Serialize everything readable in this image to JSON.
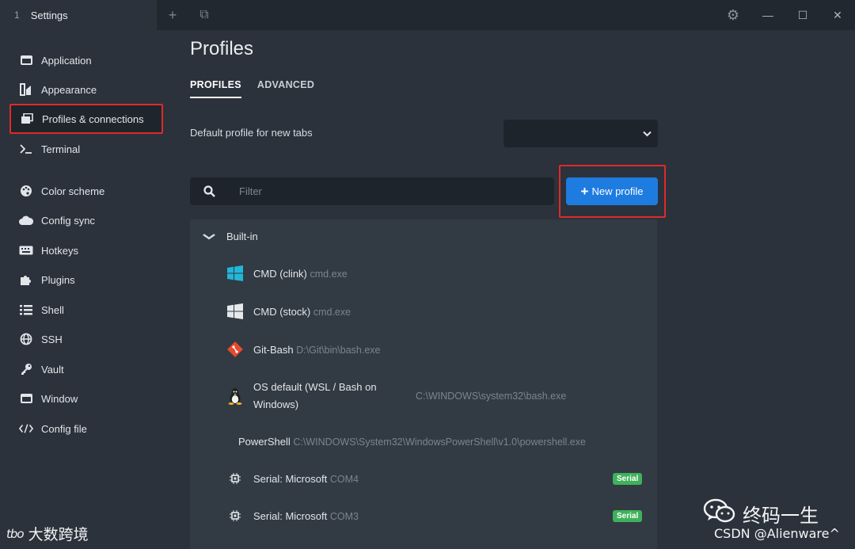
{
  "titlebar": {
    "tab_index": "1",
    "tab_title": "Settings",
    "add_tab": "+",
    "copy_icon": "⧉",
    "settings_icon": "⚙",
    "minimize": "—",
    "maximize": "☐",
    "close": "✕"
  },
  "sidebar": {
    "items": [
      {
        "label": "Application",
        "icon": "window-icon"
      },
      {
        "label": "Appearance",
        "icon": "appearance-icon"
      },
      {
        "label": "Profiles & connections",
        "icon": "profiles-icon"
      },
      {
        "label": "Terminal",
        "icon": "terminal-icon"
      },
      {
        "label": "Color scheme",
        "icon": "palette-icon"
      },
      {
        "label": "Config sync",
        "icon": "cloud-icon"
      },
      {
        "label": "Hotkeys",
        "icon": "keyboard-icon"
      },
      {
        "label": "Plugins",
        "icon": "puzzle-icon"
      },
      {
        "label": "Shell",
        "icon": "list-icon"
      },
      {
        "label": "SSH",
        "icon": "globe-icon"
      },
      {
        "label": "Vault",
        "icon": "key-icon"
      },
      {
        "label": "Window",
        "icon": "window-icon"
      },
      {
        "label": "Config file",
        "icon": "code-icon"
      }
    ],
    "selected_index": 2
  },
  "main": {
    "title": "Profiles",
    "tabs": [
      {
        "label": "PROFILES",
        "active": true
      },
      {
        "label": "ADVANCED",
        "active": false
      }
    ],
    "default_profile_label": "Default profile for new tabs",
    "default_profile_value": "",
    "filter_placeholder": "Filter",
    "new_profile_label": "New profile",
    "group": {
      "label": "Built-in",
      "expanded": true,
      "profiles": [
        {
          "name": "CMD (clink)",
          "command": "cmd.exe",
          "icon": "windows-color-icon"
        },
        {
          "name": "CMD (stock)",
          "command": "cmd.exe",
          "icon": "windows-icon"
        },
        {
          "name": "Git-Bash",
          "command": "D:\\Git\\bin\\bash.exe",
          "icon": "git-icon"
        },
        {
          "name": "OS default (WSL / Bash on Windows)",
          "command": "C:\\WINDOWS\\system32\\bash.exe",
          "icon": "linux-icon"
        },
        {
          "name": "PowerShell",
          "command": "C:\\WINDOWS\\System32\\WindowsPowerShell\\v1.0\\powershell.exe",
          "icon": ""
        },
        {
          "name": "Serial: Microsoft",
          "command": "COM4",
          "icon": "chip-icon",
          "badge": "Serial"
        },
        {
          "name": "Serial: Microsoft",
          "command": "COM3",
          "icon": "chip-icon",
          "badge": "Serial"
        }
      ]
    }
  },
  "watermark": {
    "left_text": "大数跨境",
    "left_logo": "tbo",
    "brand": "终码一生",
    "csdn": "CSDN @Alienware^"
  },
  "colors": {
    "accent": "#1e7ce0",
    "highlight_frame": "#e02a2a",
    "badge": "#3fb15a",
    "background": "#2b323b"
  }
}
